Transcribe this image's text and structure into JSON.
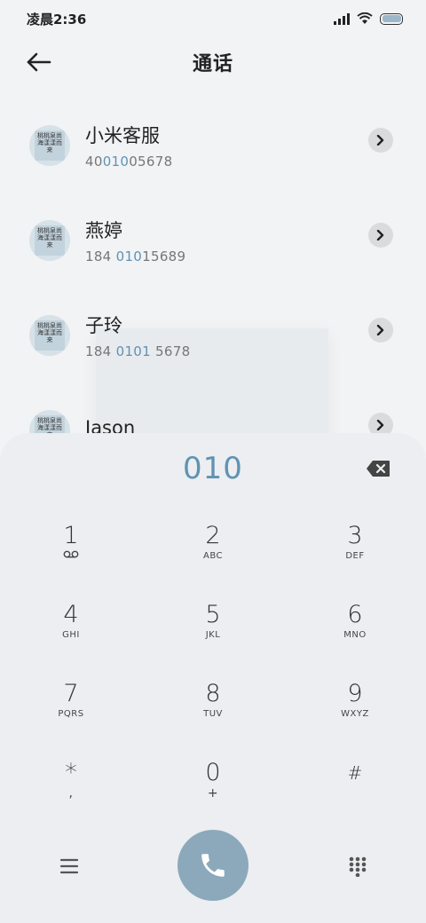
{
  "status_bar": {
    "time": "凌晨2:36",
    "icons": [
      "signal-icon",
      "wifi-icon",
      "battery-icon"
    ],
    "battery_level": 1.0
  },
  "header": {
    "title": "通话",
    "back_icon": "arrow-left-icon"
  },
  "contacts": [
    {
      "name": "小米客服",
      "number_parts": [
        "40",
        "010",
        "05678"
      ],
      "avatar_text": "桃桃泉尚海漾漾而来"
    },
    {
      "name": "燕婷",
      "number_parts": [
        "184 ",
        "010",
        "15689"
      ],
      "avatar_text": "桃桃泉尚海漾漾而来"
    },
    {
      "name": "子玲",
      "number_parts": [
        "184 ",
        "0101",
        " 5678"
      ],
      "avatar_text": "桃桃泉尚海漾漾而来"
    },
    {
      "name": "Jason",
      "number_parts": [
        "",
        "",
        ""
      ],
      "avatar_text": "桃桃泉尚海漾漾而来"
    }
  ],
  "dialpad": {
    "typed_number": "010",
    "backspace_icon": "backspace-icon",
    "keys": [
      {
        "main": "1",
        "sub": "voicemail"
      },
      {
        "main": "2",
        "sub": "ABC"
      },
      {
        "main": "3",
        "sub": "DEF"
      },
      {
        "main": "4",
        "sub": "GHI"
      },
      {
        "main": "5",
        "sub": "JKL"
      },
      {
        "main": "6",
        "sub": "MNO"
      },
      {
        "main": "7",
        "sub": "PQRS"
      },
      {
        "main": "8",
        "sub": "TUV"
      },
      {
        "main": "9",
        "sub": "WXYZ"
      },
      {
        "main": "*",
        "sub": ","
      },
      {
        "main": "0",
        "sub": "+"
      },
      {
        "main": "#",
        "sub": ""
      }
    ],
    "menu_icon": "menu-icon",
    "call_icon": "phone-icon",
    "grid_icon": "dialpad-grid-icon"
  },
  "colors": {
    "accent": "#5f93b3",
    "call_button": "#8ba9ba",
    "background": "#f2f3f5"
  }
}
